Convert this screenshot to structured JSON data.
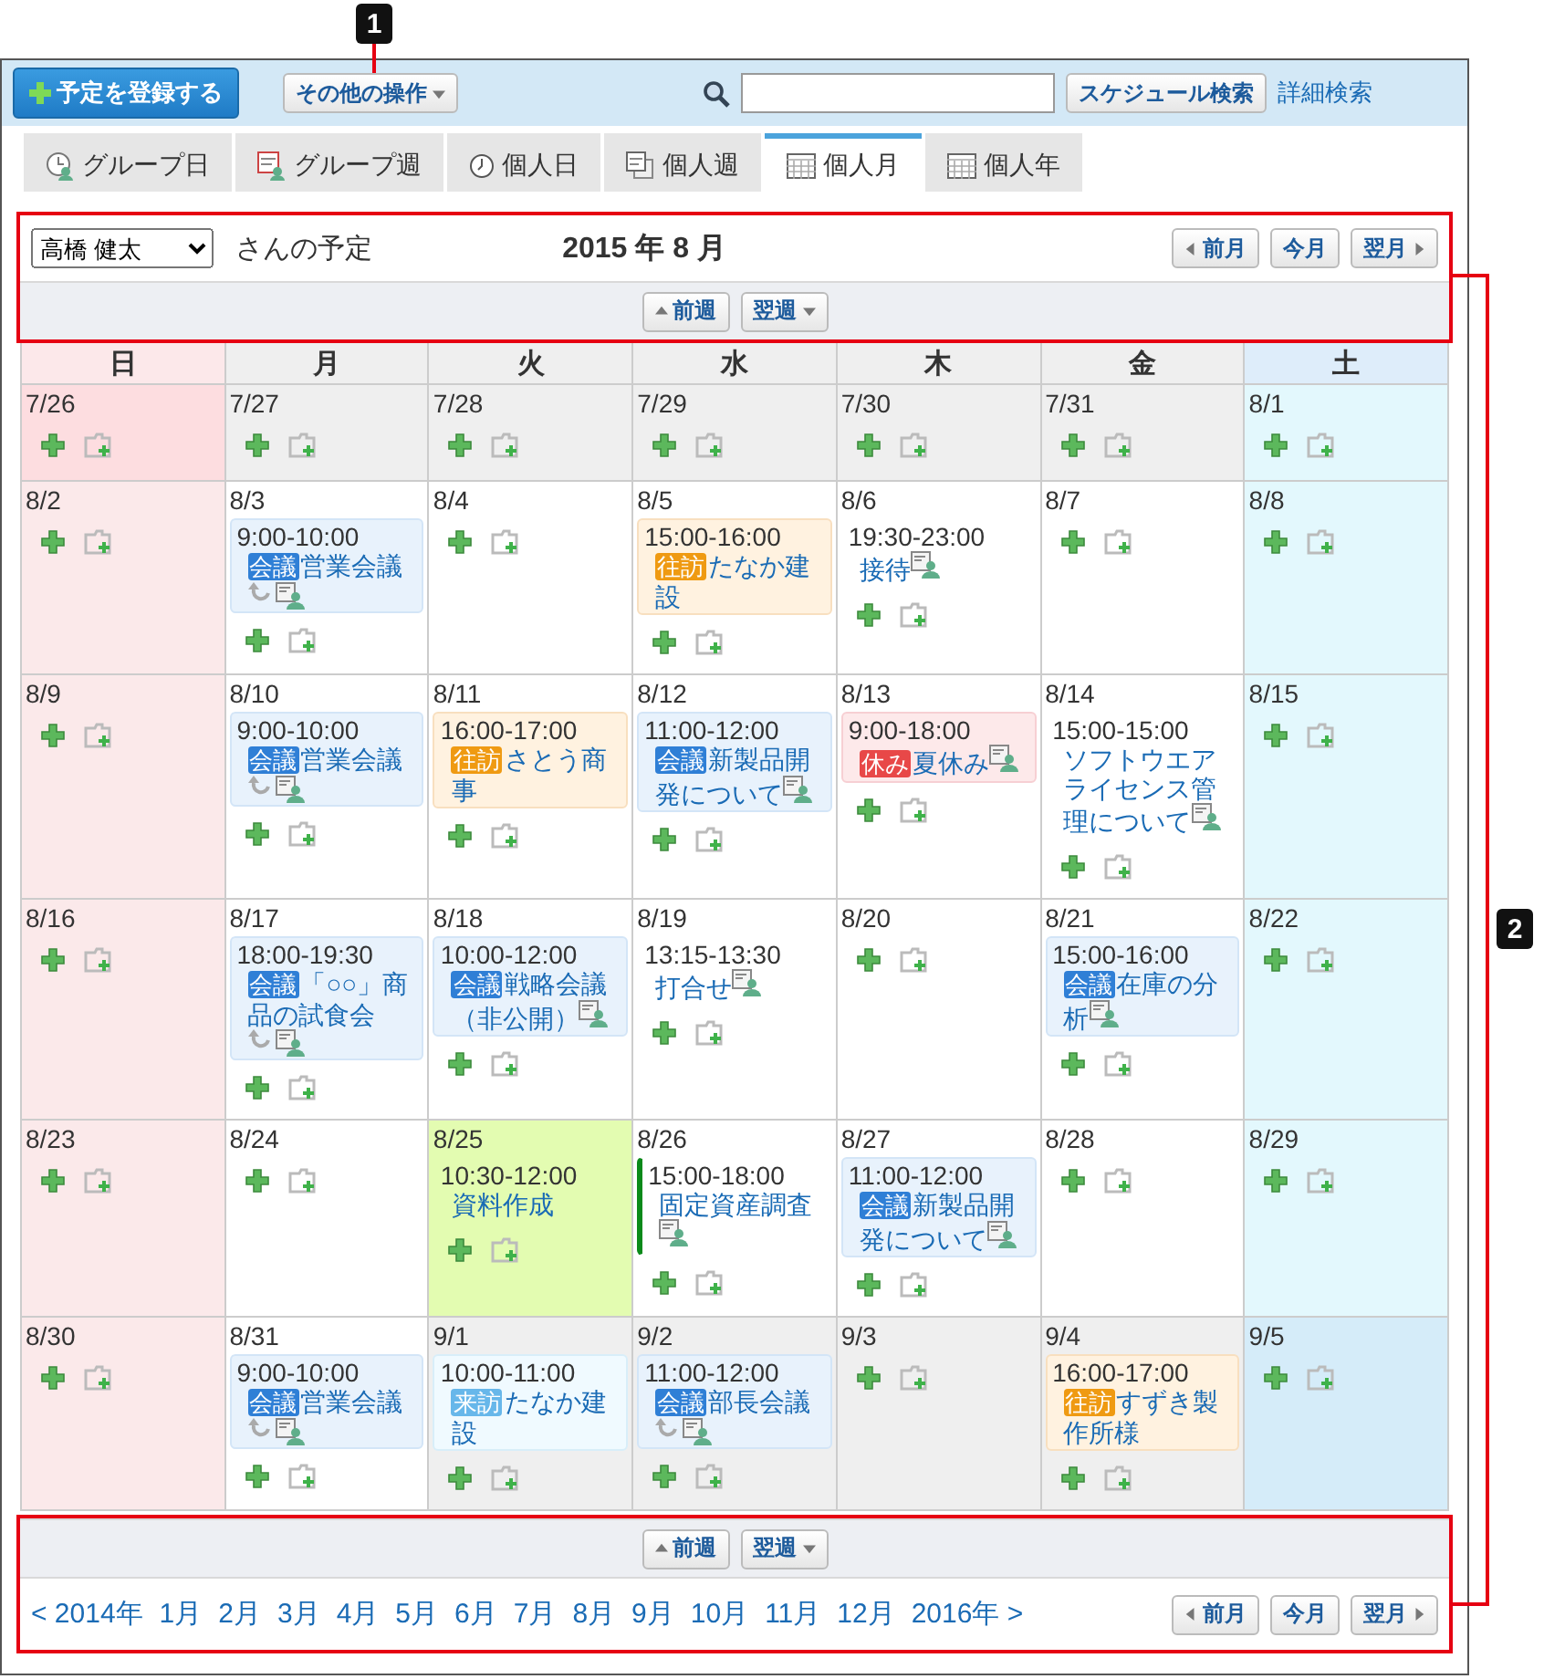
{
  "callouts": [
    {
      "label": "1"
    },
    {
      "label": "2"
    }
  ],
  "toolbar": {
    "add_button": "予定を登録する",
    "more_menu": "その他の操作",
    "search_button": "スケジュール検索",
    "advanced_link": "詳細検索"
  },
  "tabs": [
    {
      "label": "グループ日",
      "kind": "group-day",
      "selected": false
    },
    {
      "label": "グループ週",
      "kind": "group-week",
      "selected": false
    },
    {
      "label": "個人日",
      "kind": "day",
      "selected": false
    },
    {
      "label": "個人週",
      "kind": "week",
      "selected": false
    },
    {
      "label": "個人月",
      "kind": "month",
      "selected": true
    },
    {
      "label": "個人年",
      "kind": "year",
      "selected": false
    }
  ],
  "header": {
    "user": "高橋 健太",
    "suffix": "さんの予定",
    "title": "2015 年 8 月",
    "month_buttons": [
      "前月",
      "今月",
      "翌月"
    ],
    "week_buttons": [
      "前週",
      "翌週"
    ]
  },
  "weekdays": [
    {
      "label": "日",
      "kind": "sunday"
    },
    {
      "label": "月",
      "kind": "weekday"
    },
    {
      "label": "火",
      "kind": "weekday"
    },
    {
      "label": "水",
      "kind": "weekday"
    },
    {
      "label": "木",
      "kind": "weekday"
    },
    {
      "label": "金",
      "kind": "weekday"
    },
    {
      "label": "土",
      "kind": "saturday"
    }
  ],
  "weeks": [
    [
      {
        "date": "7/26",
        "kind": "sunday",
        "other_month": true
      },
      {
        "date": "7/27",
        "kind": "weekday",
        "other_month": true
      },
      {
        "date": "7/28",
        "kind": "weekday",
        "other_month": true
      },
      {
        "date": "7/29",
        "kind": "weekday",
        "other_month": true
      },
      {
        "date": "7/30",
        "kind": "weekday",
        "other_month": true
      },
      {
        "date": "7/31",
        "kind": "weekday",
        "other_month": true
      },
      {
        "date": "8/1",
        "kind": "saturday",
        "other_month": false
      }
    ],
    [
      {
        "date": "8/2",
        "kind": "sunday",
        "other_month": false
      },
      {
        "date": "8/3",
        "kind": "weekday",
        "other_month": false,
        "events": [
          {
            "time": "9:00-10:00",
            "kind": "meeting",
            "tag": "会議",
            "title": "営業会議",
            "recurring": true,
            "shared": true
          }
        ]
      },
      {
        "date": "8/4",
        "kind": "weekday",
        "other_month": false
      },
      {
        "date": "8/5",
        "kind": "weekday",
        "other_month": false,
        "events": [
          {
            "time": "15:00-16:00",
            "kind": "visit",
            "tag": "往訪",
            "title": "たなか建設",
            "recurring": false,
            "shared": false
          }
        ]
      },
      {
        "date": "8/6",
        "kind": "weekday",
        "other_month": false,
        "events": [
          {
            "time": "19:30-23:00",
            "kind": "plain",
            "title": "接待",
            "recurring": false,
            "shared": true
          }
        ]
      },
      {
        "date": "8/7",
        "kind": "weekday",
        "other_month": false
      },
      {
        "date": "8/8",
        "kind": "saturday",
        "other_month": false
      }
    ],
    [
      {
        "date": "8/9",
        "kind": "sunday",
        "other_month": false
      },
      {
        "date": "8/10",
        "kind": "weekday",
        "other_month": false,
        "events": [
          {
            "time": "9:00-10:00",
            "kind": "meeting",
            "tag": "会議",
            "title": "営業会議",
            "recurring": true,
            "shared": true
          }
        ]
      },
      {
        "date": "8/11",
        "kind": "weekday",
        "other_month": false,
        "events": [
          {
            "time": "16:00-17:00",
            "kind": "visit",
            "tag": "往訪",
            "title": "さとう商事",
            "recurring": false,
            "shared": false
          }
        ]
      },
      {
        "date": "8/12",
        "kind": "weekday",
        "other_month": false,
        "events": [
          {
            "time": "11:00-12:00",
            "kind": "meeting",
            "tag": "会議",
            "title": "新製品開発について",
            "recurring": false,
            "shared": true
          }
        ]
      },
      {
        "date": "8/13",
        "kind": "weekday",
        "other_month": false,
        "events": [
          {
            "time": "9:00-18:00",
            "kind": "holiday",
            "tag": "休み",
            "title": "夏休み",
            "recurring": false,
            "shared": true
          }
        ]
      },
      {
        "date": "8/14",
        "kind": "weekday",
        "other_month": false,
        "events": [
          {
            "time": "15:00-15:00",
            "kind": "plain",
            "title": "ソフトウエアライセンス管理について",
            "recurring": false,
            "shared": true
          }
        ]
      },
      {
        "date": "8/15",
        "kind": "saturday",
        "other_month": false
      }
    ],
    [
      {
        "date": "8/16",
        "kind": "sunday",
        "other_month": false
      },
      {
        "date": "8/17",
        "kind": "weekday",
        "other_month": false,
        "events": [
          {
            "time": "18:00-19:30",
            "kind": "meeting",
            "tag": "会議",
            "title": "「○○」商品の試食会",
            "recurring": true,
            "shared": true
          }
        ]
      },
      {
        "date": "8/18",
        "kind": "weekday",
        "other_month": false,
        "events": [
          {
            "time": "10:00-12:00",
            "kind": "meeting",
            "tag": "会議",
            "title": "戦略会議（非公開）",
            "recurring": false,
            "shared": true
          }
        ]
      },
      {
        "date": "8/19",
        "kind": "weekday",
        "other_month": false,
        "events": [
          {
            "time": "13:15-13:30",
            "kind": "plain",
            "title": "打合せ",
            "recurring": false,
            "shared": true
          }
        ]
      },
      {
        "date": "8/20",
        "kind": "weekday",
        "other_month": false
      },
      {
        "date": "8/21",
        "kind": "weekday",
        "other_month": false,
        "events": [
          {
            "time": "15:00-16:00",
            "kind": "meeting",
            "tag": "会議",
            "title": "在庫の分析",
            "recurring": false,
            "shared": true
          }
        ]
      },
      {
        "date": "8/22",
        "kind": "saturday",
        "other_month": false
      }
    ],
    [
      {
        "date": "8/23",
        "kind": "sunday",
        "other_month": false
      },
      {
        "date": "8/24",
        "kind": "weekday",
        "other_month": false
      },
      {
        "date": "8/25",
        "kind": "today",
        "other_month": false,
        "events": [
          {
            "time": "10:30-12:00",
            "kind": "plain",
            "title": "資料作成",
            "recurring": false,
            "shared": false
          }
        ]
      },
      {
        "date": "8/26",
        "kind": "weekday",
        "other_month": false,
        "events": [
          {
            "time": "15:00-18:00",
            "kind": "marked",
            "title": "固定資産調査",
            "recurring": false,
            "shared": true
          }
        ]
      },
      {
        "date": "8/27",
        "kind": "weekday",
        "other_month": false,
        "events": [
          {
            "time": "11:00-12:00",
            "kind": "meeting",
            "tag": "会議",
            "title": "新製品開発について",
            "recurring": false,
            "shared": true
          }
        ]
      },
      {
        "date": "8/28",
        "kind": "weekday",
        "other_month": false
      },
      {
        "date": "8/29",
        "kind": "saturday",
        "other_month": false
      }
    ],
    [
      {
        "date": "8/30",
        "kind": "sunday",
        "other_month": false
      },
      {
        "date": "8/31",
        "kind": "weekday",
        "other_month": false,
        "events": [
          {
            "time": "9:00-10:00",
            "kind": "meeting",
            "tag": "会議",
            "title": "営業会議",
            "recurring": true,
            "shared": true
          }
        ]
      },
      {
        "date": "9/1",
        "kind": "weekday",
        "other_month": true,
        "events": [
          {
            "time": "10:00-11:00",
            "kind": "visitor",
            "tag": "来訪",
            "title": "たなか建設",
            "recurring": false,
            "shared": false
          }
        ]
      },
      {
        "date": "9/2",
        "kind": "weekday",
        "other_month": true,
        "events": [
          {
            "time": "11:00-12:00",
            "kind": "meeting",
            "tag": "会議",
            "title": "部長会議",
            "recurring": true,
            "shared": true
          }
        ]
      },
      {
        "date": "9/3",
        "kind": "weekday",
        "other_month": true
      },
      {
        "date": "9/4",
        "kind": "weekday",
        "other_month": true,
        "events": [
          {
            "time": "16:00-17:00",
            "kind": "visit",
            "tag": "往訪",
            "title": "すずき製作所様",
            "recurring": false,
            "shared": false
          }
        ]
      },
      {
        "date": "9/5",
        "kind": "saturday",
        "other_month": true
      }
    ]
  ],
  "footer": {
    "week_buttons": [
      "前週",
      "翌週"
    ],
    "prev_year": "< 2014年",
    "months": [
      "1月",
      "2月",
      "3月",
      "4月",
      "5月",
      "6月",
      "7月",
      "8月",
      "9月",
      "10月",
      "11月",
      "12月"
    ],
    "next_year": "2016年 >",
    "month_buttons": [
      "前月",
      "今月",
      "翌月"
    ]
  }
}
